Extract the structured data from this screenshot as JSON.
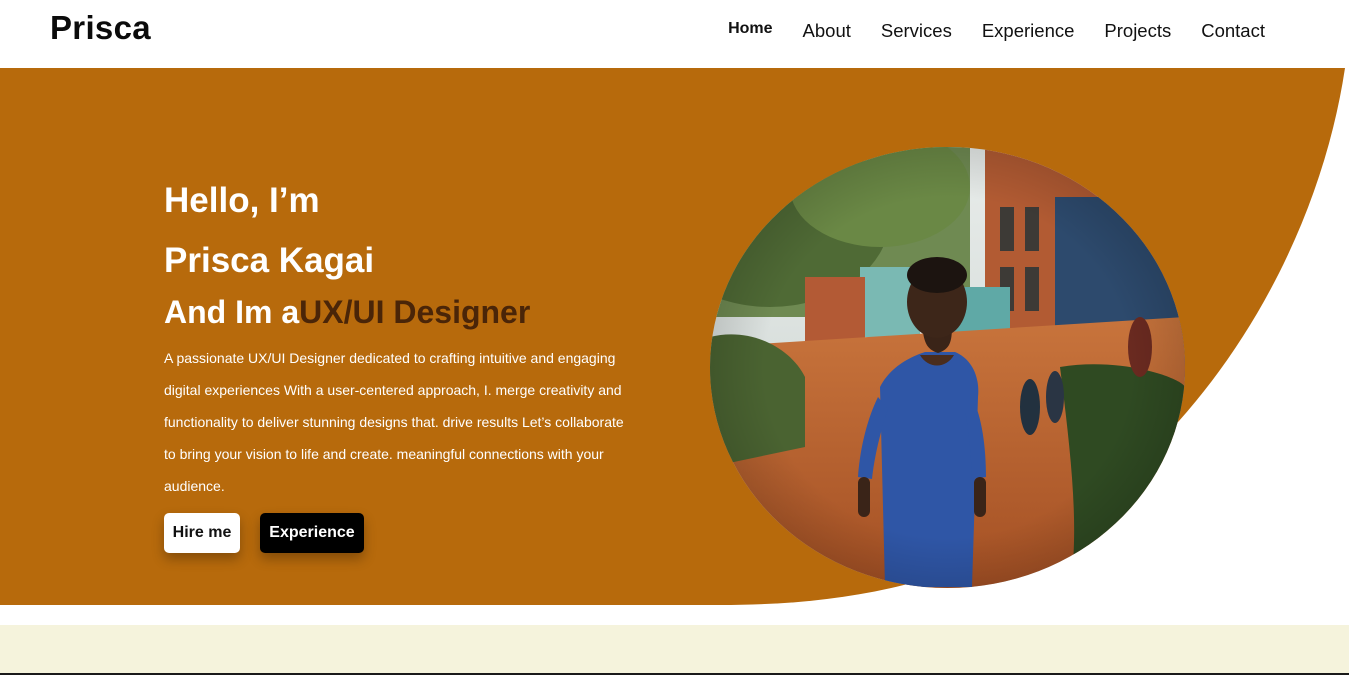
{
  "header": {
    "brand": "Prisca",
    "nav": [
      {
        "label": "Home"
      },
      {
        "label": "About"
      },
      {
        "label": "Services"
      },
      {
        "label": "Experience"
      },
      {
        "label": "Projects"
      },
      {
        "label": "Contact"
      }
    ]
  },
  "hero": {
    "greeting": "Hello, I’m",
    "name": "Prisca Kagai",
    "role_prefix": "And Im a",
    "role": "UX/UI Designer",
    "bio": "A passionate UX/UI Designer dedicated to crafting intuitive and engaging digital experiences With a user-centered approach, I. merge creativity and functionality to deliver stunning designs that. drive results Let’s collaborate to bring your vision to life and create. meaningful connections with your audience.",
    "hire_label": "Hire me",
    "experience_label": "Experience"
  },
  "colors": {
    "hero_background": "#b76a0c",
    "accent_text": "#4a2508",
    "lower_section": "#f5f3dc"
  }
}
